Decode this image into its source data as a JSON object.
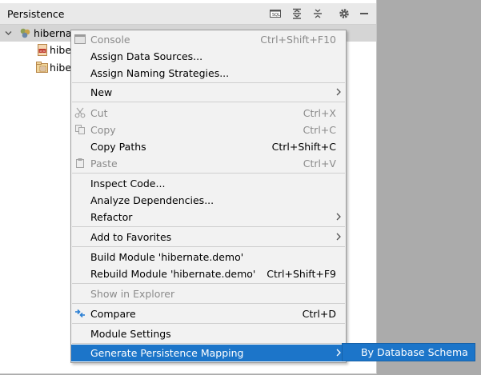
{
  "tool_window": {
    "title": "Persistence",
    "icons": [
      "sql-console-icon",
      "expand-all-icon",
      "collapse-all-icon",
      "gear-icon",
      "minimize-icon"
    ]
  },
  "tree": {
    "root": {
      "label": "hibernat",
      "icon": "module-icon"
    },
    "children": [
      {
        "label": "hibe",
        "icon": "hibernate-config-icon"
      },
      {
        "label": "hibe",
        "icon": "persistence-unit-icon"
      }
    ]
  },
  "menu": {
    "items": [
      {
        "id": "console",
        "label": "Console",
        "shortcut": "Ctrl+Shift+F10",
        "enabled": false,
        "icon": "console-icon"
      },
      {
        "id": "assign-data-sources",
        "label": "Assign Data Sources...",
        "shortcut": "",
        "enabled": true
      },
      {
        "id": "assign-naming-strategies",
        "label": "Assign Naming Strategies...",
        "shortcut": "",
        "enabled": true
      },
      {
        "id": "new",
        "label": "New",
        "shortcut": "",
        "enabled": true,
        "submenu": true
      },
      {
        "id": "cut",
        "label": "Cut",
        "shortcut": "Ctrl+X",
        "enabled": false,
        "icon": "cut-icon"
      },
      {
        "id": "copy",
        "label": "Copy",
        "shortcut": "Ctrl+C",
        "enabled": false,
        "icon": "copy-icon"
      },
      {
        "id": "copy-paths",
        "label": "Copy Paths",
        "shortcut": "Ctrl+Shift+C",
        "enabled": true
      },
      {
        "id": "paste",
        "label": "Paste",
        "shortcut": "Ctrl+V",
        "enabled": false,
        "icon": "paste-icon"
      },
      {
        "id": "inspect-code",
        "label": "Inspect Code...",
        "shortcut": "",
        "enabled": true
      },
      {
        "id": "analyze-dependencies",
        "label": "Analyze Dependencies...",
        "shortcut": "",
        "enabled": true
      },
      {
        "id": "refactor",
        "label": "Refactor",
        "shortcut": "",
        "enabled": true,
        "submenu": true
      },
      {
        "id": "add-to-favorites",
        "label": "Add to Favorites",
        "shortcut": "",
        "enabled": true,
        "submenu": true
      },
      {
        "id": "build-module",
        "label": "Build Module 'hibernate.demo'",
        "shortcut": "",
        "enabled": true
      },
      {
        "id": "rebuild-module",
        "label": "Rebuild Module 'hibernate.demo'",
        "shortcut": "Ctrl+Shift+F9",
        "enabled": true
      },
      {
        "id": "show-in-explorer",
        "label": "Show in Explorer",
        "shortcut": "",
        "enabled": false
      },
      {
        "id": "compare",
        "label": "Compare",
        "shortcut": "Ctrl+D",
        "enabled": true,
        "icon": "compare-icon"
      },
      {
        "id": "module-settings",
        "label": "Module Settings",
        "shortcut": "",
        "enabled": true
      },
      {
        "id": "generate-persistence-mapping",
        "label": "Generate Persistence Mapping",
        "shortcut": "",
        "enabled": true,
        "submenu": true,
        "selected": true
      }
    ]
  },
  "submenu": {
    "items": [
      {
        "label": "By Database Schema",
        "selected": true
      }
    ]
  },
  "colors": {
    "selection": "#1c75c9",
    "menu_background": "#f2f2f2",
    "disabled_text": "#8b8b8b"
  }
}
